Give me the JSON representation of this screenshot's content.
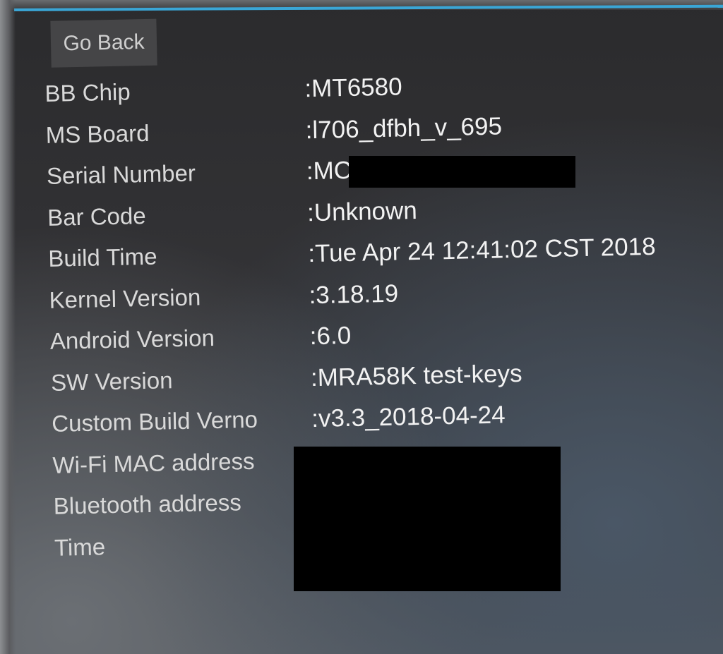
{
  "header": {
    "back_button_label": "Go Back"
  },
  "info_rows": [
    {
      "label": "BB Chip",
      "value": ":MT6580"
    },
    {
      "label": "MS Board",
      "value": ":l706_dfbh_v_695"
    },
    {
      "label": "Serial Number",
      "value": ":MC"
    },
    {
      "label": "Bar Code",
      "value": ":Unknown"
    },
    {
      "label": "Build Time",
      "value": ":Tue Apr 24 12:41:02 CST 2018"
    },
    {
      "label": "Kernel Version",
      "value": ":3.18.19"
    },
    {
      "label": "Android Version",
      "value": ":6.0"
    },
    {
      "label": "SW Version",
      "value": ":MRA58K test-keys"
    },
    {
      "label": "Custom Build Verno",
      "value": ":v3.3_2018-04-24"
    },
    {
      "label": "Wi-Fi MAC address",
      "value": ""
    },
    {
      "label": "Bluetooth address",
      "value": ":"
    },
    {
      "label": "Time",
      "value": ":"
    }
  ],
  "colors": {
    "accent": "#3aa6d6",
    "background": "#2f2f31",
    "text": "#d9d9d9",
    "button": "#454547",
    "redaction": "#000000"
  }
}
